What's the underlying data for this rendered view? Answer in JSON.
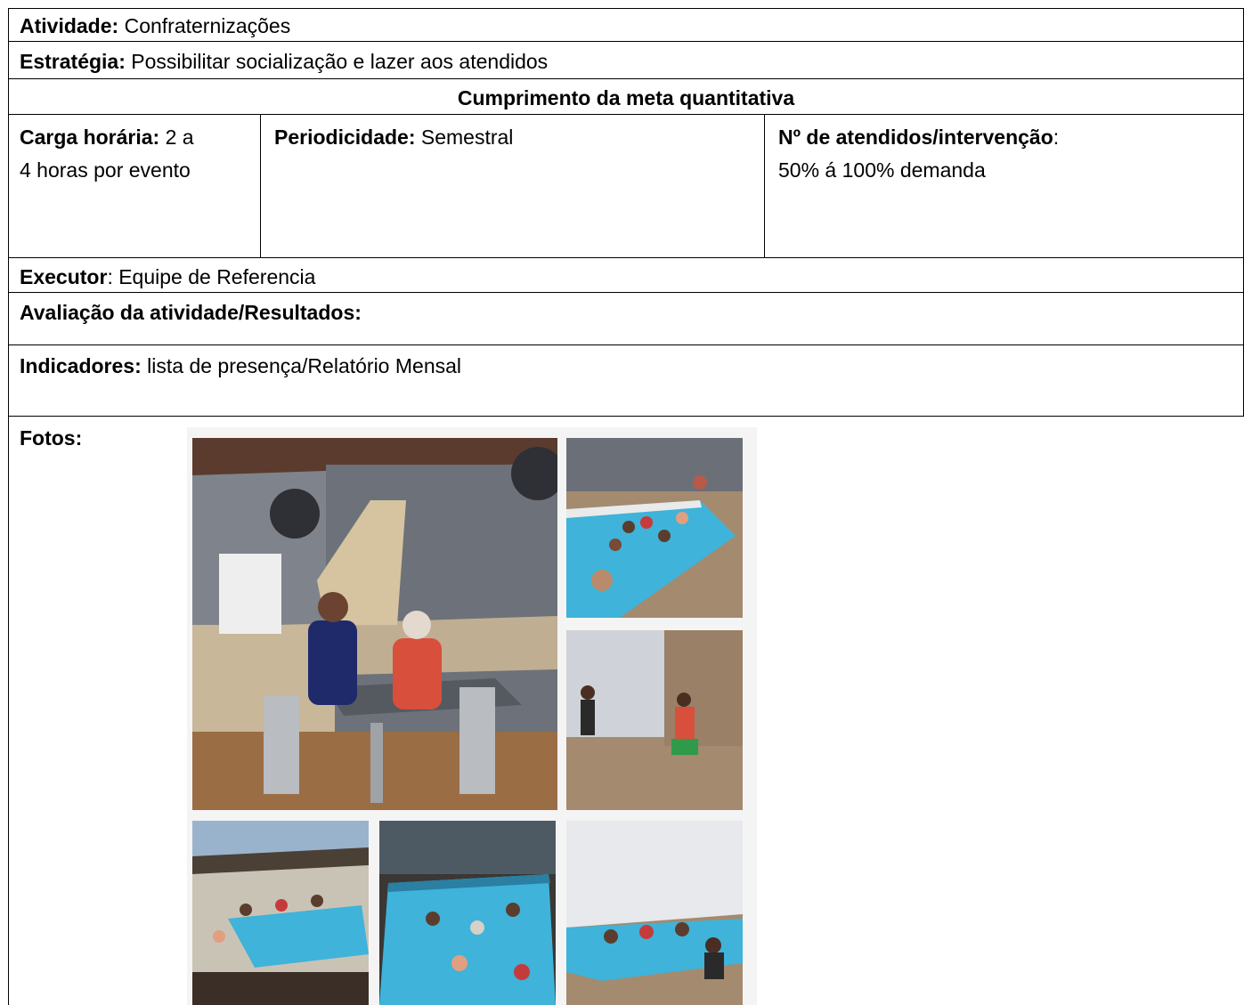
{
  "atividade": {
    "label": "Atividade:",
    "value": " Confraternizações"
  },
  "estrategia": {
    "label": "Estratégia:",
    "value": " Possibilitar socialização e lazer aos atendidos"
  },
  "meta_header": "Cumprimento da meta quantitativa",
  "carga": {
    "label": "Carga horária:",
    "value_line1": " 2 a",
    "value_line2": "4 horas por evento"
  },
  "periodicidade": {
    "label": "Periodicidade:",
    "value": " Semestral"
  },
  "atendidos": {
    "label": "Nº de atendidos/intervenção",
    "sep": ":",
    "value": "50% á 100% demanda"
  },
  "executor": {
    "label": "Executor",
    "value": ": Equipe de Referencia"
  },
  "avaliacao": {
    "label": "Avaliação da atividade/Resultados:"
  },
  "indicadores": {
    "label": "Indicadores:",
    "value": " lista de presença/Relatório Mensal"
  },
  "fotos": {
    "label": "Fotos:"
  },
  "colors": {
    "pool": "#3fb3d9",
    "wall": "#8a8e96",
    "floor": "#a48a6e",
    "brick": "#c9b79a"
  }
}
